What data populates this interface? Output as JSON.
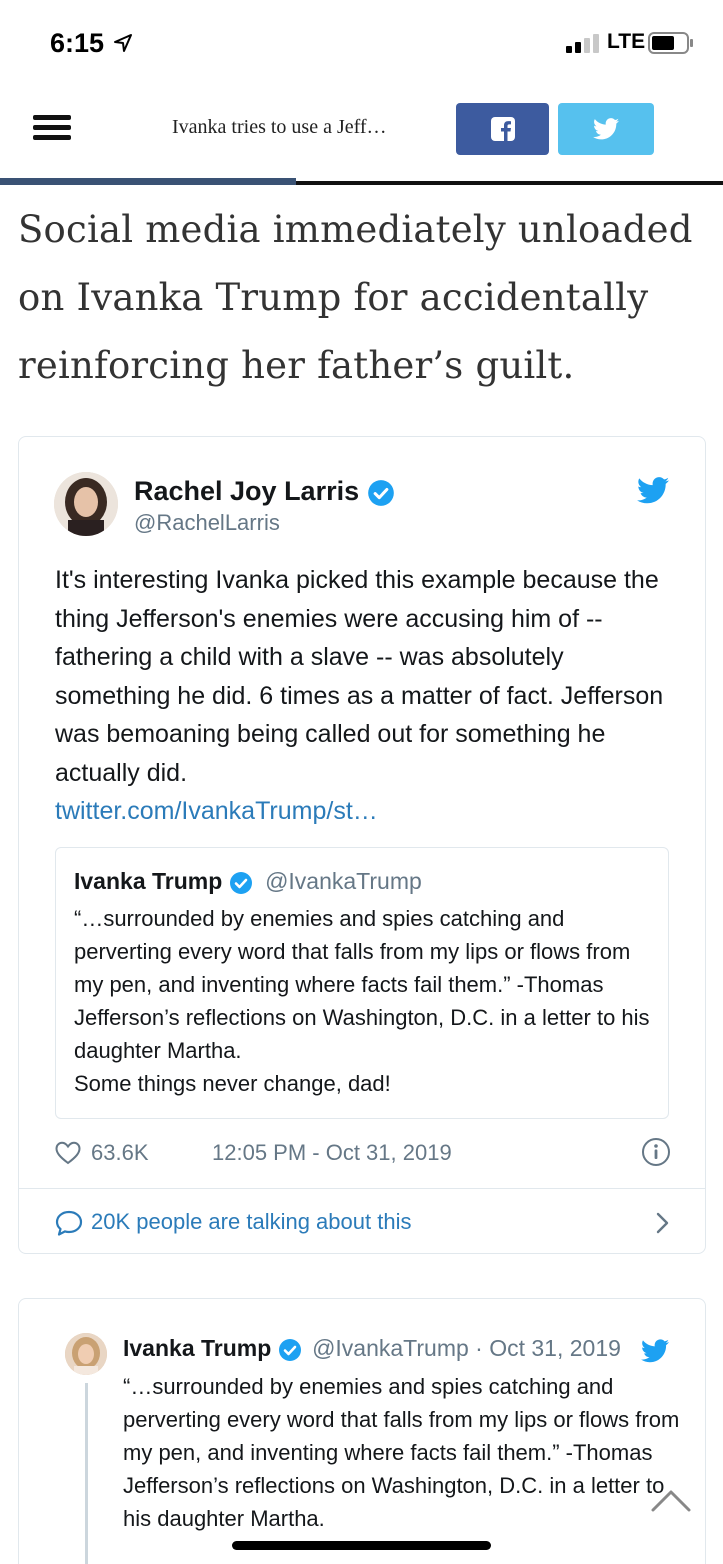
{
  "status_bar": {
    "time": "6:15",
    "network": "LTE"
  },
  "header": {
    "title": "Ivanka tries to use a Jeff…",
    "reading_progress": 0.41
  },
  "article": {
    "lead": "Social media immediately unloaded on Ivanka Trump for accidentally reinforcing her father’s guilt."
  },
  "tweet": {
    "author_name": "Rachel Joy Larris",
    "author_handle": "@RachelLarris",
    "text": "It's interesting Ivanka picked this example because the thing Jefferson's enemies were accusing him of -- fathering a child with a slave -- was absolutely something he did. 6 times as a matter of fact. Jefferson was bemoaning being called out for something he actually did.",
    "link": "twitter.com/IvankaTrump/st…",
    "quote": {
      "author_name": "Ivanka Trump",
      "author_handle": "@IvankaTrump",
      "text": "“…surrounded by enemies and spies catching and perverting every word that falls from my lips or flows from my pen, and inventing where facts fail them.” -Thomas Jefferson’s reflections on Washington, D.C. in a letter to his daughter Martha.",
      "text2": "Some things never change, dad!"
    },
    "likes": "63.6K",
    "timestamp": "12:05 PM - Oct 31, 2019",
    "talking": "20K people are talking about this"
  },
  "tweet2": {
    "author_name": "Ivanka Trump",
    "author_handle": "@IvankaTrump · Oct 31, 2019",
    "text": "“…surrounded by enemies and spies catching and perverting every word that falls from my lips or flows from my pen, and inventing where facts fail them.” -Thomas Jefferson’s reflections on Washington, D.C. in a letter to his daughter Martha."
  },
  "colors": {
    "facebook": "#3d5b9f",
    "twitter": "#56c1ee",
    "link": "#2b7bb9",
    "verified": "#1da1f2"
  }
}
